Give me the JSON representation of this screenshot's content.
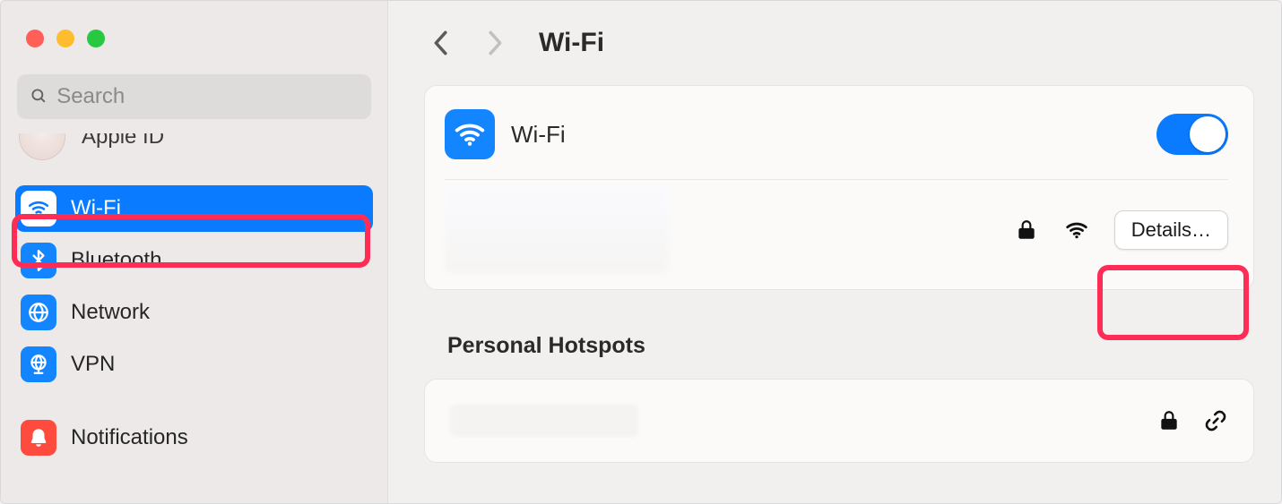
{
  "window": {
    "title_nav": "Wi-Fi"
  },
  "search": {
    "placeholder": "Search"
  },
  "account": {
    "label": "Apple ID"
  },
  "sidebar": {
    "items": [
      {
        "label": "Wi-Fi",
        "icon": "wifi-icon",
        "active": true
      },
      {
        "label": "Bluetooth",
        "icon": "bluetooth-icon"
      },
      {
        "label": "Network",
        "icon": "globe-icon"
      },
      {
        "label": "VPN",
        "icon": "vpn-globe-icon"
      },
      {
        "label": "Notifications",
        "icon": "bell-icon"
      }
    ]
  },
  "main": {
    "wifi_label": "Wi-Fi",
    "wifi_on": true,
    "details_label": "Details…",
    "section_hotspots": "Personal Hotspots"
  },
  "highlights": {
    "sidebar_wifi": true,
    "details_button": true
  },
  "colors": {
    "accent": "#0a7bff",
    "highlight": "#ff2d55"
  }
}
